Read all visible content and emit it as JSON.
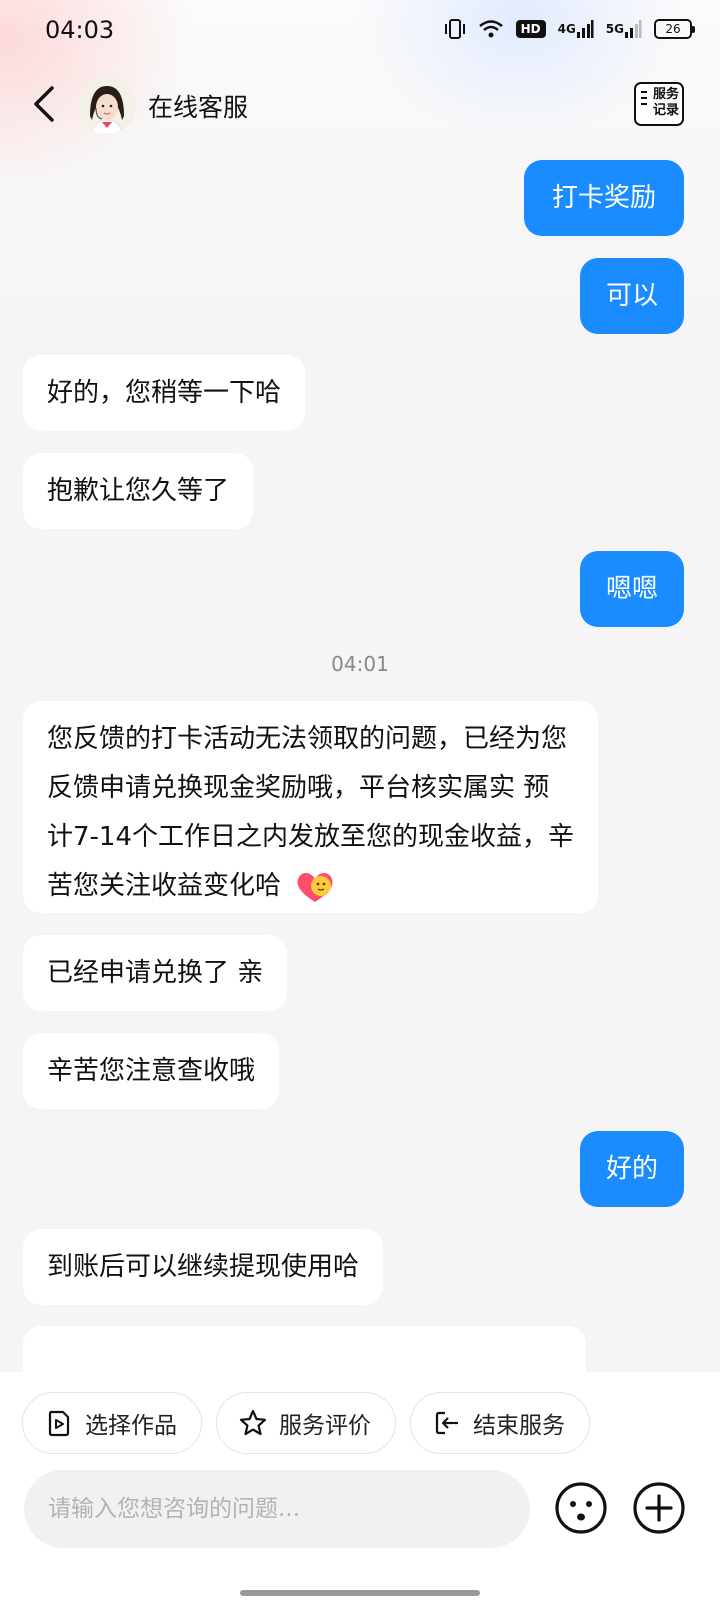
{
  "status_bar": {
    "time": "04:03",
    "network_4g": "4G",
    "network_5g": "5G",
    "hd_label": "HD",
    "battery": "26"
  },
  "header": {
    "title": "在线客服",
    "service_record_line1": "服务",
    "service_record_line2": "记录"
  },
  "messages": [
    {
      "side": "out",
      "text": "打卡奖励"
    },
    {
      "side": "out",
      "text": "可以"
    },
    {
      "side": "in",
      "text": "好的，您稍等一下哈"
    },
    {
      "side": "in",
      "text": "抱歉让您久等了"
    },
    {
      "side": "out",
      "text": "嗯嗯"
    },
    {
      "side": "in",
      "text": "您反馈的打卡活动无法领取的问题，已经为您反馈申请兑换现金奖励哦，平台核实属实 预计7-14个工作日之内发放至您的现金收益，辛苦您关注收益变化哈"
    },
    {
      "side": "in",
      "text": "已经申请兑换了 亲"
    },
    {
      "side": "in",
      "text": "辛苦您注意查收哦"
    },
    {
      "side": "out",
      "text": "好的"
    },
    {
      "side": "in",
      "text": "到账后可以继续提现使用哈"
    }
  ],
  "timestamp_divider": "04:01",
  "quick_actions": [
    {
      "label": "选择作品",
      "icon": "video-file-icon"
    },
    {
      "label": "服务评价",
      "icon": "star-icon"
    },
    {
      "label": "结束服务",
      "icon": "exit-icon"
    }
  ],
  "input": {
    "placeholder": "请输入您想咨询的问题...",
    "value": ""
  },
  "colors": {
    "accent": "#1a8cff",
    "incoming_bubble": "#ffffff",
    "background": "#f5f5f5"
  }
}
